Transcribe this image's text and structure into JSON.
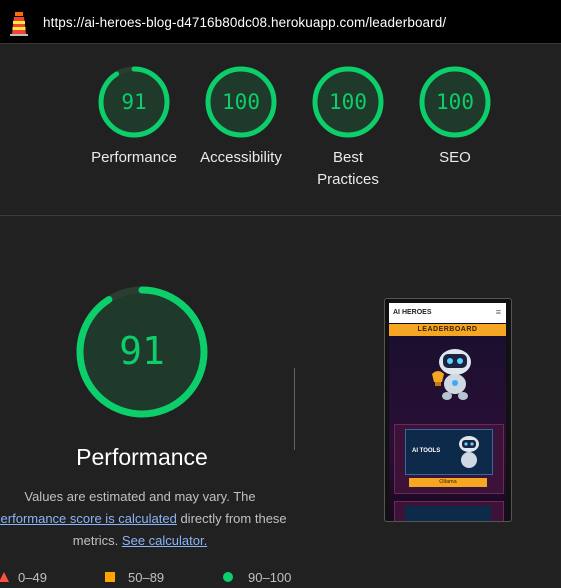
{
  "topbar": {
    "url": "https://ai-heroes-blog-d4716b80dc08.herokuapp.com/leaderboard/"
  },
  "scores": [
    {
      "score": "91",
      "label": "Performance",
      "fraction": 0.91
    },
    {
      "score": "100",
      "label": "Accessibility",
      "fraction": 1.0
    },
    {
      "score": "100",
      "label": "Best Practices",
      "fraction": 1.0
    },
    {
      "score": "100",
      "label": "SEO",
      "fraction": 1.0
    }
  ],
  "main": {
    "score": "91",
    "fraction": 0.91,
    "title": "Performance",
    "note_prefix": "Values are estimated and may vary. The ",
    "note_link": "performance score is calculated",
    "note_middle": " directly from these metrics. ",
    "note_link2": "See calculator."
  },
  "legend": [
    {
      "range": "0–49",
      "color": "#ff4e42"
    },
    {
      "range": "50–89",
      "color": "#ffa400"
    },
    {
      "range": "90–100",
      "color": "#0cce6b"
    }
  ],
  "screenshot": {
    "brand": "AI HEROES",
    "banner": "LEADERBOARD",
    "card_title": "AI TOOLS",
    "card_button": "Ollama"
  },
  "colors": {
    "pass": "#0cce6b",
    "background": "#212121",
    "link": "#8ab4f8"
  }
}
